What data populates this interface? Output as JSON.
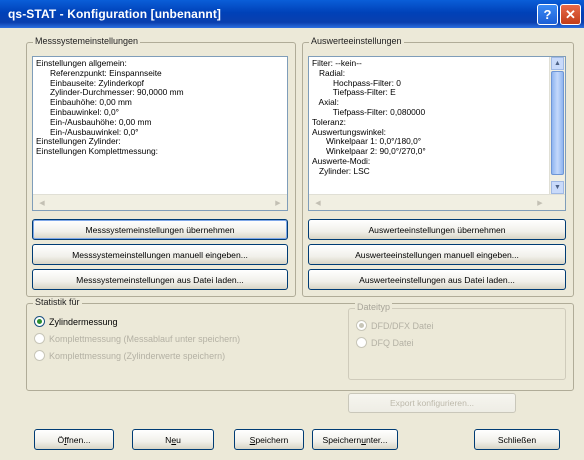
{
  "window": {
    "title": "qs-STAT - Konfiguration [unbenannt]",
    "help_glyph": "?",
    "close_glyph": "✕"
  },
  "messsystem": {
    "group_label": "Messsystemeinstellungen",
    "lines": [
      "Einstellungen allgemein:",
      "      Referenzpunkt: Einspannseite",
      "      Einbauseite: Zylinderkopf",
      "      Zylinder-Durchmesser: 90,0000 mm",
      "      Einbauhöhe: 0,00 mm",
      "      Einbauwinkel: 0,0°",
      "      Ein-/Ausbauhöhe: 0,00 mm",
      "      Ein-/Ausbauwinkel: 0,0°",
      "Einstellungen Zylinder:",
      "Einstellungen Komplettmessung:"
    ],
    "buttons": {
      "apply": "Messsystemeinstellungen übernehmen",
      "manual": "Messsystemeinstellungen manuell eingeben...",
      "load_file": "Messsystemeinstellungen aus Datei laden..."
    }
  },
  "auswerte": {
    "group_label": "Auswerteeinstellungen",
    "lines": [
      "Filter: --kein--",
      "   Radial:",
      "         Hochpass-Filter: 0",
      "         Tiefpass-Filter: E",
      "   Axial:",
      "         Tiefpass-Filter: 0,080000",
      "Toleranz:",
      "Auswertungswinkel:",
      "      Winkelpaar 1: 0,0°/180,0°",
      "      Winkelpaar 2: 90,0°/270,0°",
      "Auswerte-Modi:",
      "   Zylinder: LSC"
    ],
    "buttons": {
      "apply": "Auswerteeinstellungen übernehmen",
      "manual": "Auswerteeinstellungen manuell eingeben...",
      "load_file": "Auswerteeinstellungen aus Datei laden..."
    }
  },
  "statistik": {
    "group_label": "Statistik für",
    "options": [
      {
        "label": "Zylindermessung",
        "checked": true,
        "enabled": true
      },
      {
        "label": "Komplettmessung (Messablauf unter speichern)",
        "checked": false,
        "enabled": false
      },
      {
        "label": "Komplettmessung (Zylinderwerte speichern)",
        "checked": false,
        "enabled": false
      }
    ]
  },
  "dateiart": {
    "group_label": "Dateityp",
    "options": [
      {
        "label": "DFD/DFX Datei",
        "checked": true,
        "enabled": false
      },
      {
        "label": "DFQ Datei",
        "checked": false,
        "enabled": false
      }
    ]
  },
  "export_button": "Export konfigurieren...",
  "footer": {
    "open_pre": "Ö",
    "open_u": "f",
    "open_post": "fnen...",
    "new_pre": "N",
    "new_u": "e",
    "new_post": "u",
    "save_pre": "",
    "save_u": "S",
    "save_post": "peichern",
    "save_as_pre": "Speichern ",
    "save_as_u": "u",
    "save_as_post": "nter...",
    "close": "Schließen"
  }
}
